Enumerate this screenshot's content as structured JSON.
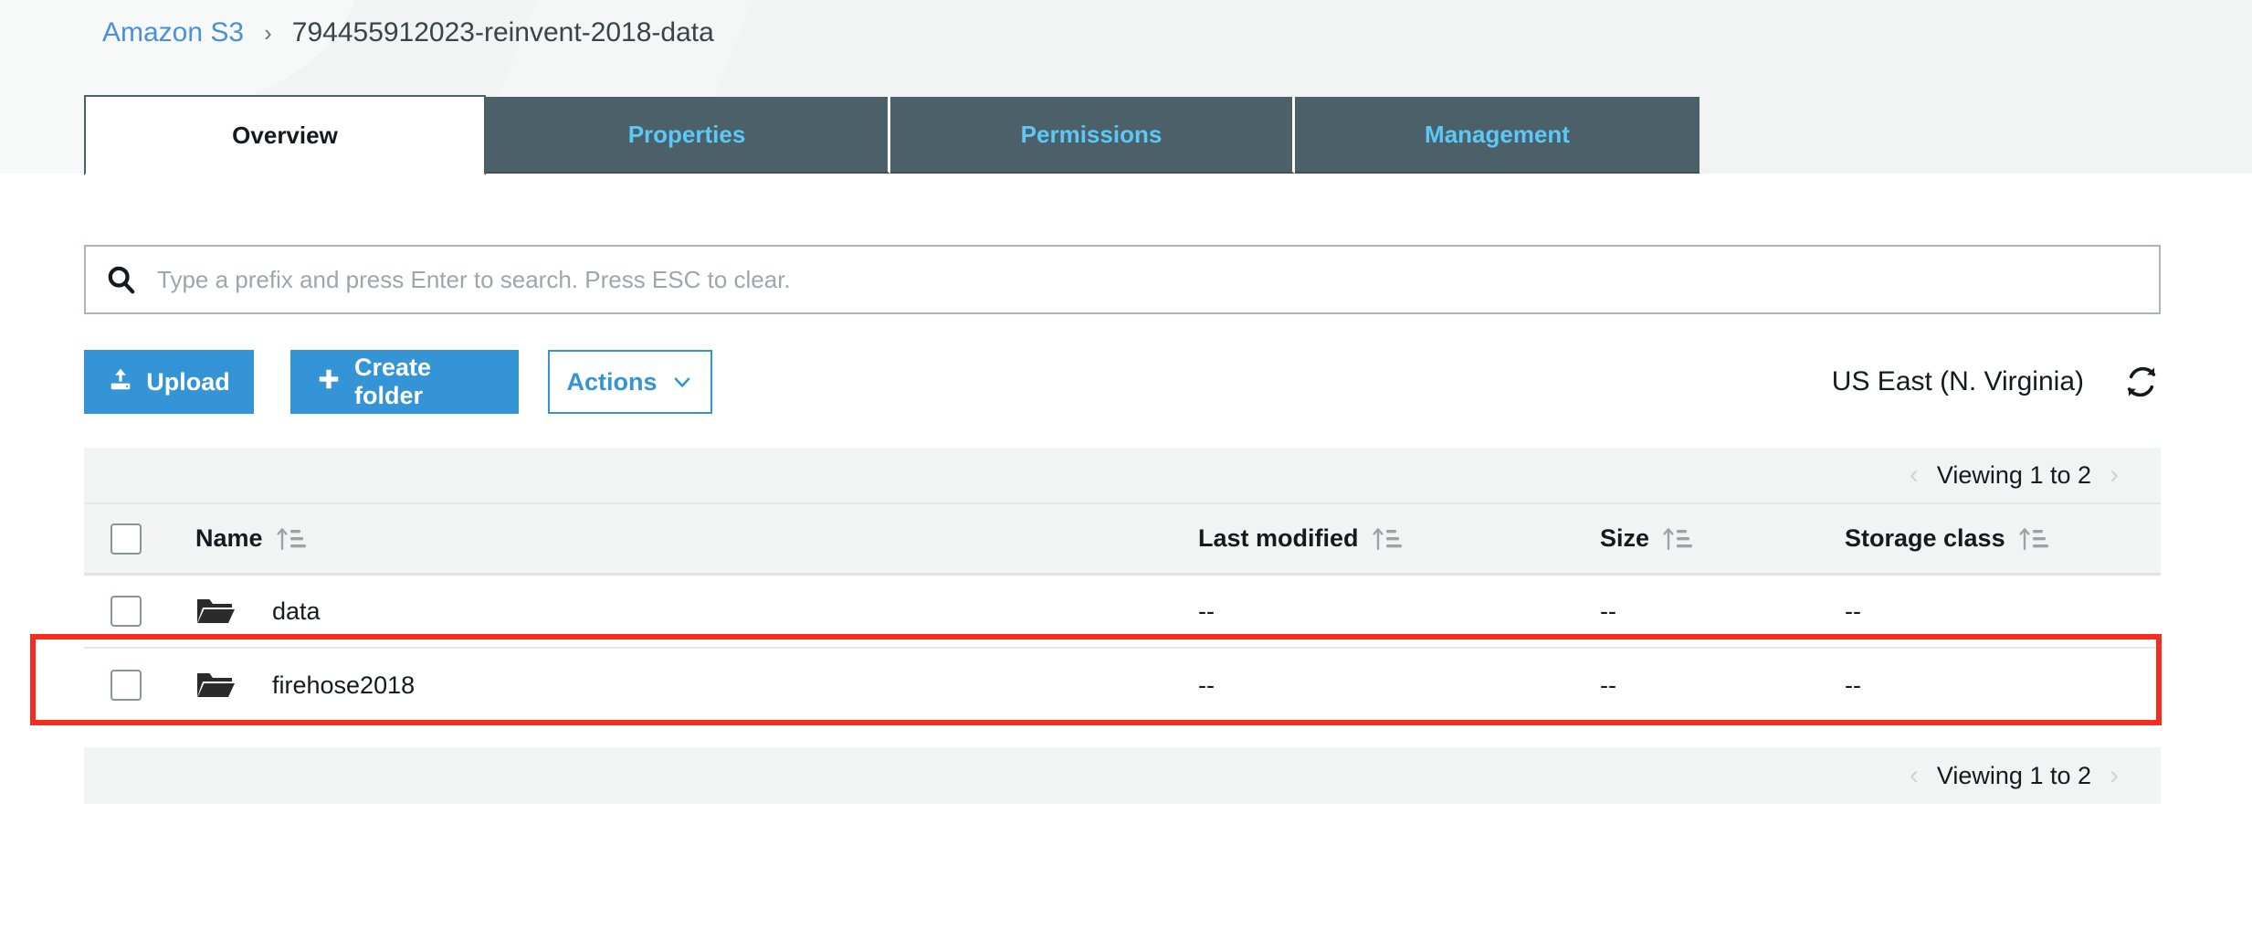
{
  "breadcrumb": {
    "root": "Amazon S3",
    "separator": "›",
    "current": "794455912023-reinvent-2018-data"
  },
  "tabs": [
    {
      "label": "Overview",
      "active": true
    },
    {
      "label": "Properties",
      "active": false
    },
    {
      "label": "Permissions",
      "active": false
    },
    {
      "label": "Management",
      "active": false
    }
  ],
  "search": {
    "placeholder": "Type a prefix and press Enter to search. Press ESC to clear.",
    "value": "",
    "icon": "search-icon"
  },
  "toolbar": {
    "upload_label": "Upload",
    "upload_icon": "upload-icon",
    "create_folder_label": "Create folder",
    "create_folder_icon": "plus-icon",
    "actions_label": "Actions",
    "actions_icon": "chevron-down-icon",
    "region": "US East (N. Virginia)",
    "refresh_icon": "refresh-icon"
  },
  "pagination": {
    "prev": "‹",
    "next": "›",
    "text": "Viewing 1 to 2"
  },
  "table": {
    "columns": [
      {
        "label": "Name",
        "sort_icon": "sort-ascending-icon"
      },
      {
        "label": "Last modified",
        "sort_icon": "sort-ascending-icon"
      },
      {
        "label": "Size",
        "sort_icon": "sort-ascending-icon"
      },
      {
        "label": "Storage class",
        "sort_icon": "sort-ascending-icon"
      }
    ],
    "rows": [
      {
        "name": "data",
        "icon": "folder-icon",
        "last_modified": "--",
        "size": "--",
        "storage_class": "--",
        "selected": false,
        "highlighted": false
      },
      {
        "name": "firehose2018",
        "icon": "folder-icon",
        "last_modified": "--",
        "size": "--",
        "storage_class": "--",
        "selected": false,
        "highlighted": true
      }
    ]
  },
  "colors": {
    "accent_blue": "#3494d6",
    "link_blue": "#4a90d9",
    "tab_inactive_bg": "#4c6069",
    "tab_inactive_text": "#5bc8f5",
    "band_bg": "#f2f4f4",
    "annotation_red": "#f62c1e",
    "text_dark": "#16191f"
  }
}
